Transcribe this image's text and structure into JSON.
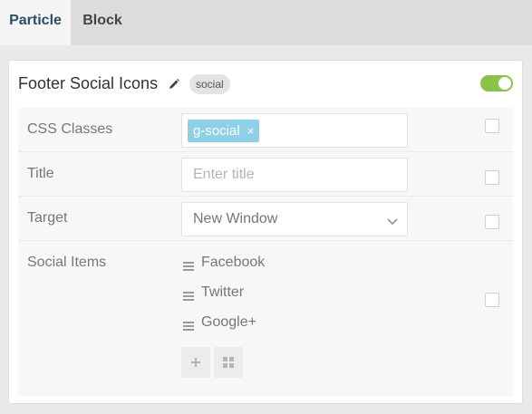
{
  "tabs": [
    {
      "label": "Particle",
      "active": true
    },
    {
      "label": "Block",
      "active": false
    }
  ],
  "card": {
    "title": "Footer Social Icons",
    "type_badge": "social",
    "enabled": true,
    "edit_icon": "pencil-icon"
  },
  "fields": {
    "css_classes": {
      "label": "CSS Classes",
      "tags": [
        "g-social"
      ]
    },
    "title": {
      "label": "Title",
      "value": "",
      "placeholder": "Enter title"
    },
    "target": {
      "label": "Target",
      "value": "New Window"
    },
    "social_items": {
      "label": "Social Items",
      "items": [
        "Facebook",
        "Twitter",
        "Google+"
      ],
      "add_button": "plus-icon",
      "grid_button": "grid-icon"
    }
  },
  "colors": {
    "toggle_on": "#8bc34a",
    "tag_bg": "#8fd0e9",
    "active_tab_text": "#2c4f5f"
  }
}
